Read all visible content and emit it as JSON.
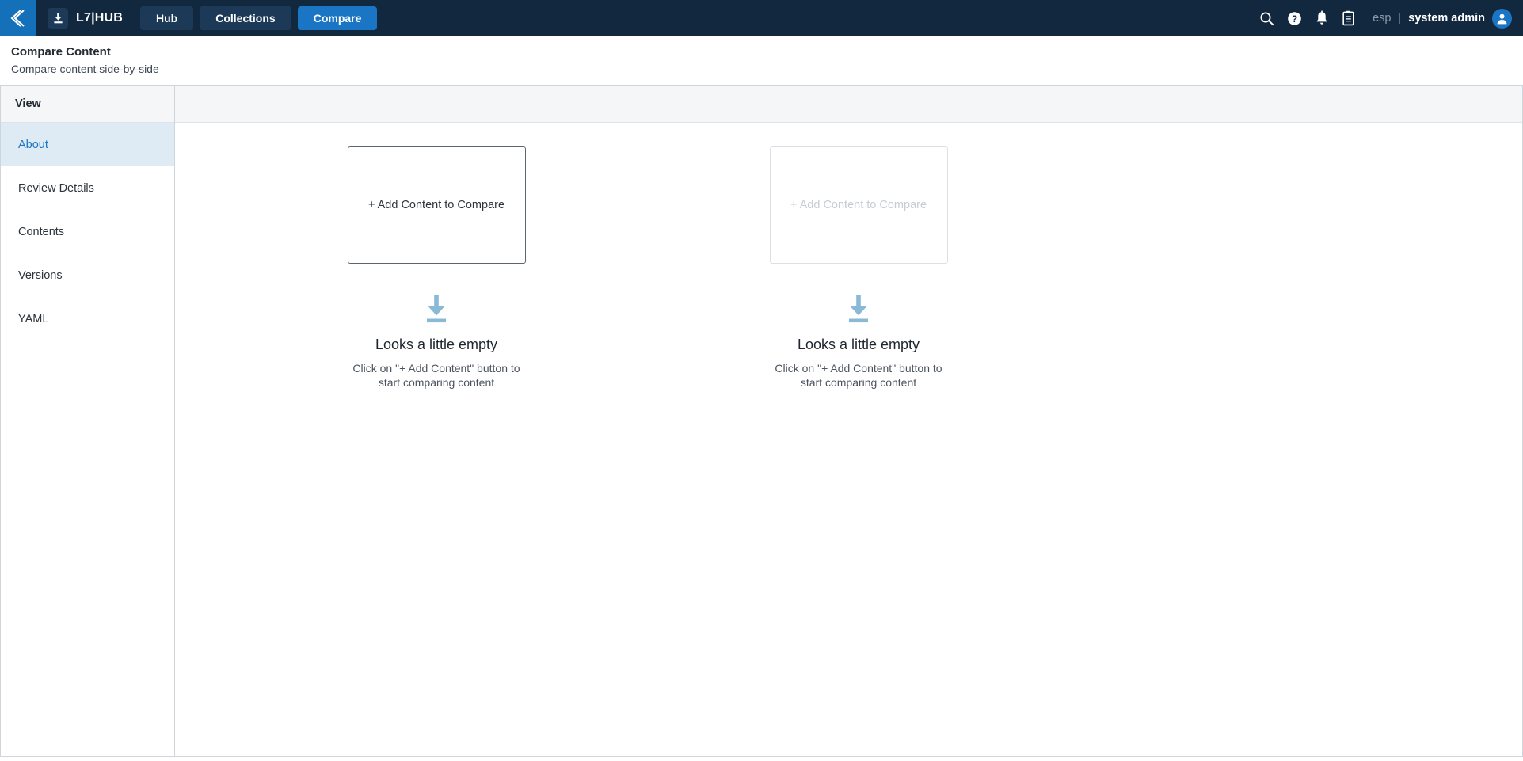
{
  "topbar": {
    "back_icon": "chevron-left-icon",
    "brand_logo_icon": "download-icon",
    "brand_name": "L7|HUB",
    "tabs": [
      {
        "label": "Hub",
        "active": false
      },
      {
        "label": "Collections",
        "active": false
      },
      {
        "label": "Compare",
        "active": true
      }
    ],
    "icons": [
      {
        "name": "search-icon"
      },
      {
        "name": "help-icon"
      },
      {
        "name": "notifications-bell-icon"
      },
      {
        "name": "clipboard-icon"
      }
    ],
    "user": {
      "tenant": "esp",
      "separator": "|",
      "name": "system admin",
      "avatar_icon": "user-avatar-icon"
    }
  },
  "page": {
    "title": "Compare Content",
    "subtitle": "Compare content side-by-side"
  },
  "sidebar": {
    "header": "View",
    "items": [
      {
        "label": "About",
        "active": true
      },
      {
        "label": "Review Details",
        "active": false
      },
      {
        "label": "Contents",
        "active": false
      },
      {
        "label": "Versions",
        "active": false
      },
      {
        "label": "YAML",
        "active": false
      }
    ]
  },
  "compare": {
    "left": {
      "add_label": "+ Add Content to Compare",
      "disabled": false,
      "empty_icon": "download-arrow-icon",
      "empty_title": "Looks a little empty",
      "empty_desc": "Click on \"+ Add Content\" button to start comparing content"
    },
    "right": {
      "add_label": "+ Add Content to Compare",
      "disabled": true,
      "empty_icon": "download-arrow-icon",
      "empty_title": "Looks a little empty",
      "empty_desc": "Click on \"+ Add Content\" button to start comparing content"
    }
  },
  "colors": {
    "topbar_bg": "#12283f",
    "accent_blue": "#1a76c4",
    "back_btn_blue": "#1470b9",
    "active_nav_bg": "#deebf4",
    "empty_icon_blue": "#8ab9d6",
    "border_gray": "#cfd5db",
    "toolbar_bg": "#f5f6f7"
  }
}
